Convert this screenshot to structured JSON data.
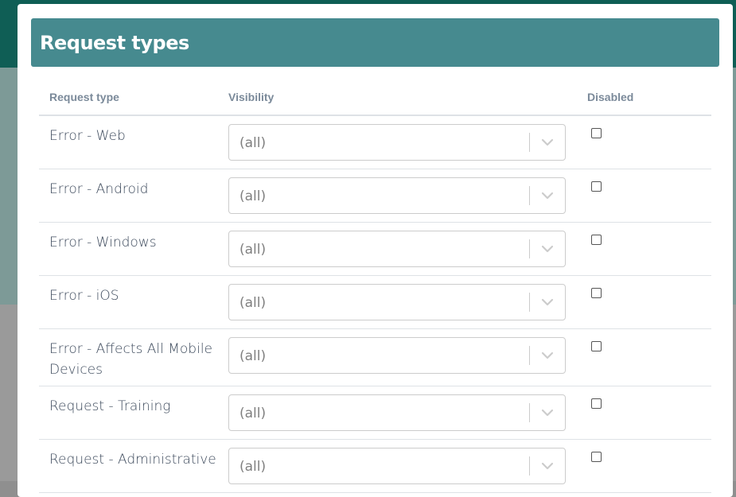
{
  "modal": {
    "title": "Request types"
  },
  "table": {
    "headers": {
      "type": "Request type",
      "visibility": "Visibility",
      "disabled": "Disabled"
    },
    "rows": [
      {
        "type": "Error - Web",
        "visibility": "(all)",
        "disabled": false
      },
      {
        "type": "Error - Android",
        "visibility": "(all)",
        "disabled": false
      },
      {
        "type": "Error - Windows",
        "visibility": "(all)",
        "disabled": false
      },
      {
        "type": "Error - iOS",
        "visibility": "(all)",
        "disabled": false
      },
      {
        "type": "Error - Affects All Mobile Devices",
        "visibility": "(all)",
        "disabled": false
      },
      {
        "type": "Request - Training",
        "visibility": "(all)",
        "disabled": false
      },
      {
        "type": "Request - Administrative",
        "visibility": "(all)",
        "disabled": false
      }
    ]
  },
  "colors": {
    "header_bg": "#468a8f",
    "backdrop_top": "#0f5e55"
  },
  "icons": {
    "dropdown": "chevron-down-icon"
  }
}
